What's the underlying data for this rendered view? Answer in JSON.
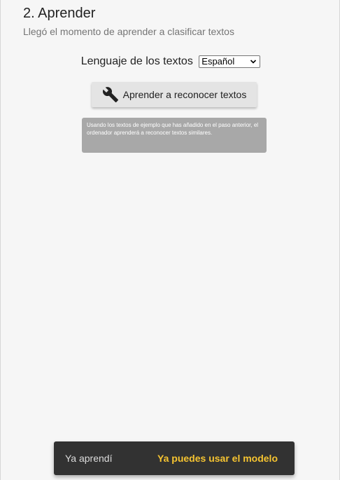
{
  "section": {
    "title": "2. Aprender",
    "subtitle": "Llegó el momento de aprender a clasificar textos"
  },
  "language": {
    "label": "Lenguaje de los textos",
    "selected": "Español"
  },
  "learn_button": {
    "label": "Aprender a reconocer textos",
    "icon": "wrench-icon"
  },
  "tooltip": {
    "text": "Usando los textos de ejemplo que has añadido en el paso anterior, el ordenador aprenderá a reconocer textos similares."
  },
  "snackbar": {
    "message": "Ya aprendí",
    "action": "Ya puedes usar el modelo"
  },
  "colors": {
    "snackbar_background": "#323232",
    "snackbar_action": "#f6c431",
    "tooltip_background": "#a8a8a8",
    "button_background": "#e4e4e4",
    "page_background": "#f6f6f6"
  }
}
